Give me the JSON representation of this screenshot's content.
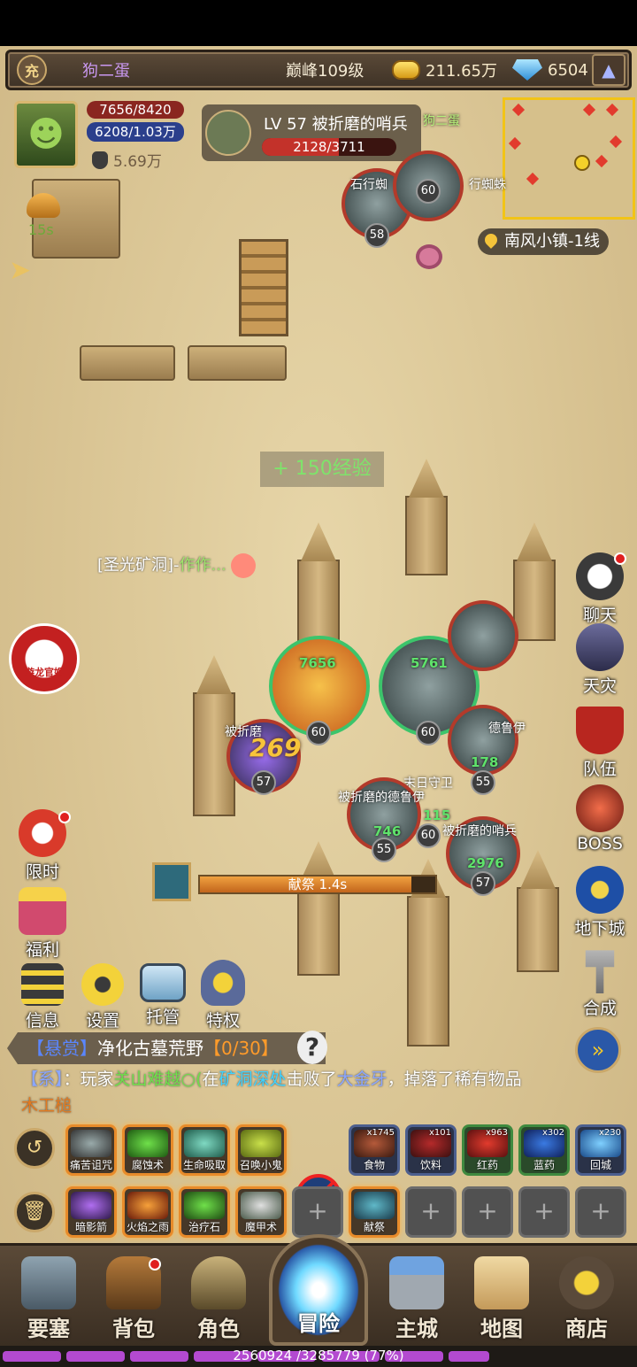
{
  "topbar": {
    "vip_label": "充",
    "player_name": "狗二蛋",
    "peak_level": "巅峰109级",
    "gold": "211.65万",
    "gems": "6504"
  },
  "player": {
    "hp": "7656/8420",
    "mp": "6208/1.03万",
    "power": "5.69万",
    "buff_timer": "15s"
  },
  "target": {
    "name": "LV 57 被折磨的哨兵",
    "hp_text": "2128/3711",
    "hp_fraction": 0.573
  },
  "minimap": {
    "location": "南风小镇-1线"
  },
  "floating": {
    "xp_gain": "+ 150经验",
    "chat_channel": "[圣光矿洞]-",
    "chat_user": "作作...",
    "damage": "269"
  },
  "units": {
    "player_hp": "7656",
    "ally_hp": "5761",
    "lv60": "60",
    "lv57": "57",
    "lv55": "55",
    "lv58": "58",
    "e1_hp": "178",
    "e2_hp": "746",
    "e3_hp": "2976",
    "e4_hp": "115",
    "label_sentinel": "被折磨的哨兵",
    "label_druid": "德鲁伊",
    "label_druid2": "被折磨的德鲁伊",
    "label_guard": "末日守卫",
    "label_stone": "石行蜘",
    "label_walker": "行蜘蛛",
    "label_partial": "被折磨",
    "top_player_name": "狗二蛋"
  },
  "castbar": {
    "label": "献祭  1.4s",
    "progress": 0.9
  },
  "logo_text": "游龙官娱",
  "right_buttons": [
    "聊天",
    "天灾",
    "队伍",
    "BOSS",
    "地下城",
    "合成"
  ],
  "left_buttons": [
    "限时",
    "福利"
  ],
  "menu_buttons": [
    "信息",
    "设置",
    "托管",
    "特权"
  ],
  "quest": {
    "tag": "【悬赏】",
    "text": "净化古墓荒野",
    "progress": "【0/30】"
  },
  "system_msg": {
    "tag": "【系】",
    "p1": "：玩家",
    "player": "关山难越○(",
    "p2": "在",
    "place": "矿洞深处",
    "p3": "击败了",
    "boss": "大金牙",
    "p4": "，掉落了稀有物品",
    "item": "木工槌"
  },
  "skills_row1": [
    "痛苦诅咒",
    "腐蚀术",
    "生命吸取",
    "召唤小鬼"
  ],
  "items_row1": [
    {
      "label": "食物",
      "count": "x1745"
    },
    {
      "label": "饮料",
      "count": "x101"
    },
    {
      "label": "红药",
      "count": "x963"
    },
    {
      "label": "蓝药",
      "count": "x302"
    },
    {
      "label": "回城",
      "count": "x230"
    }
  ],
  "skills_row2": [
    "暗影箭",
    "火焰之雨",
    "治疗石",
    "魔甲术",
    "献祭"
  ],
  "empty_slot": "+",
  "nav": [
    "要塞",
    "背包",
    "角色",
    "冒险",
    "主城",
    "地图",
    "商店"
  ],
  "exp": {
    "text": "2560924 /3285779 (77%)",
    "fraction": 0.77
  },
  "colors": {
    "gold_accent": "#f2c417",
    "hp_red": "#c3322a",
    "exp_purple": "#b34ad0"
  }
}
